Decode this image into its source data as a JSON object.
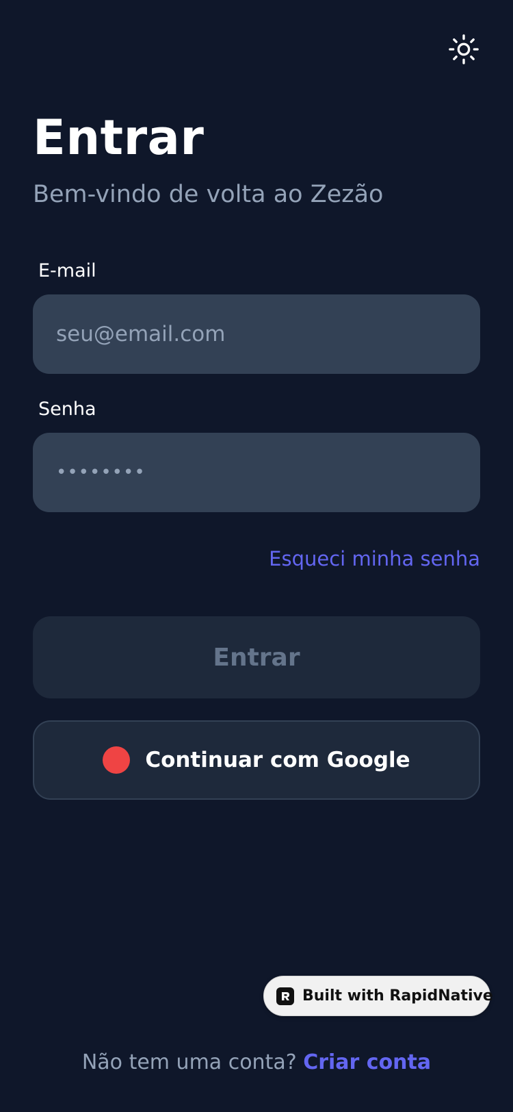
{
  "header": {
    "theme_toggle_icon": "sun-icon"
  },
  "login": {
    "title": "Entrar",
    "subtitle": "Bem-vindo de volta ao Zezão",
    "email": {
      "label": "E-mail",
      "placeholder": "seu@email.com",
      "value": ""
    },
    "password": {
      "label": "Senha",
      "placeholder": "••••••••",
      "value": ""
    },
    "forgot_password": "Esqueci minha senha",
    "submit_label": "Entrar",
    "google_label": "Continuar com Google",
    "google_icon": "google-dot-icon"
  },
  "badge": {
    "text": "Built with RapidNative",
    "icon": "rapidnative-logo-icon"
  },
  "footer": {
    "prompt": "Não tem uma conta?",
    "signup_label": "Criar conta"
  },
  "colors": {
    "background": "#0f172a",
    "input_background": "#334155",
    "button_background": "#1e293b",
    "accent": "#6366f1",
    "muted_text": "#94a3b8",
    "google_dot": "#ef4444"
  }
}
